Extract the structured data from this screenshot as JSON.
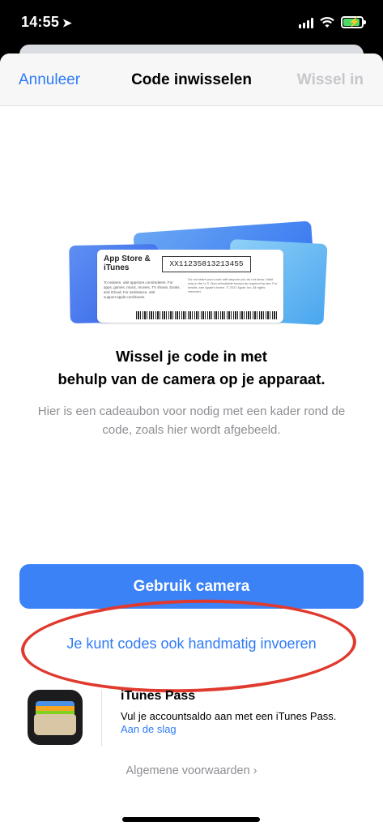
{
  "status_bar": {
    "time": "14:55",
    "location_glyph": "➤",
    "battery_color": "#4cd964"
  },
  "nav": {
    "cancel_label": "Annuleer",
    "title": "Code inwisselen",
    "redeem_label": "Wissel in"
  },
  "card": {
    "brand": "App Store & iTunes",
    "code": "XX11235813213455",
    "small_text": "To redeem, visit appstore.com/redeem. For apps, games, music, movies, TV shows, books, and iCloud. For assistance, visit support.apple.com/itunes.",
    "fine_print": "Do not share your code with anyone you do not know. Valid only in the U.S. Non-refundable except as required by law. For details, see Apple's terms. © 2017 Apple Inc. All rights reserved."
  },
  "main": {
    "heading_line1": "Wissel je code in met",
    "heading_line2": "behulp van de camera op je apparaat.",
    "subtext": "Hier is een cadeaubon voor nodig met een kader rond de code, zoals hier wordt afgebeeld.",
    "camera_button": "Gebruik camera",
    "manual_link": "Je kunt codes ook handmatig invoeren"
  },
  "itunes_pass": {
    "title": "iTunes Pass",
    "description": "Vul je accountsaldo aan met een iTunes Pass.",
    "link": "Aan de slag"
  },
  "footer": {
    "terms": "Algemene voorwaarden ›"
  },
  "colors": {
    "accent": "#2f7bf6",
    "button": "#3b82f6",
    "annotation": "#e03a2f"
  }
}
